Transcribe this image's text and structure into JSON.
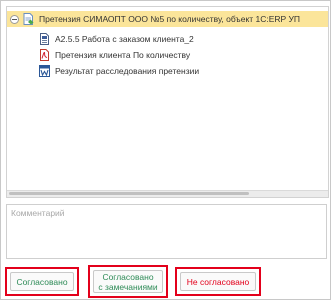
{
  "tree": {
    "root": {
      "label": "Претензия СИМАОПТ ООО №5 по количеству, объект 1С:ERP УП",
      "icon": "claim-document-icon",
      "expanded": true
    },
    "children": [
      {
        "label": "А2.5.5 Работа с заказом клиента_2",
        "icon": "document-icon"
      },
      {
        "label": "Претензия клиента По количеству",
        "icon": "pdf-icon"
      },
      {
        "label": "Результат расследования претензии",
        "icon": "word-icon"
      }
    ]
  },
  "comment": {
    "placeholder": "Комментарий",
    "value": ""
  },
  "buttons": {
    "approved": "Согласовано",
    "approved_with_remarks_line1": "Согласовано",
    "approved_with_remarks_line2": "с замечаниями",
    "rejected": "Не согласовано"
  },
  "colors": {
    "selection": "#fbe59a",
    "highlight_border": "#e3001b",
    "approved_text": "#2e8b57",
    "rejected_text": "#e3001b"
  }
}
